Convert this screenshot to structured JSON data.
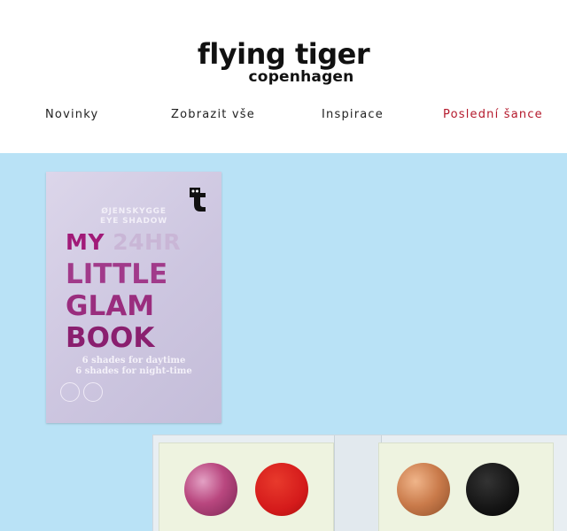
{
  "brand": {
    "line1": "flying tiger",
    "line2": "copenhagen"
  },
  "nav": [
    {
      "label": "Novinky"
    },
    {
      "label": "Zobrazit vše"
    },
    {
      "label": "Inspirace"
    },
    {
      "label": "Poslední šance",
      "color": "#b4182b"
    }
  ],
  "product": {
    "subtitle_1": "ØJENSKYGGE",
    "subtitle_2": "EYE SHADOW",
    "title_1a": "MY",
    "title_1b": "24HR",
    "title_2": "LITTLE",
    "title_3": "GLAM",
    "title_4": "BOOK",
    "desc_1": "6 shades for daytime",
    "desc_2": "6 shades for night-time"
  },
  "colors": {
    "hero_bg": "#b9e2f6",
    "accent_red": "#b4182b",
    "pan_colors": [
      "#b9477f",
      "#d51b1b",
      "#c97a4a",
      "#141414"
    ]
  }
}
